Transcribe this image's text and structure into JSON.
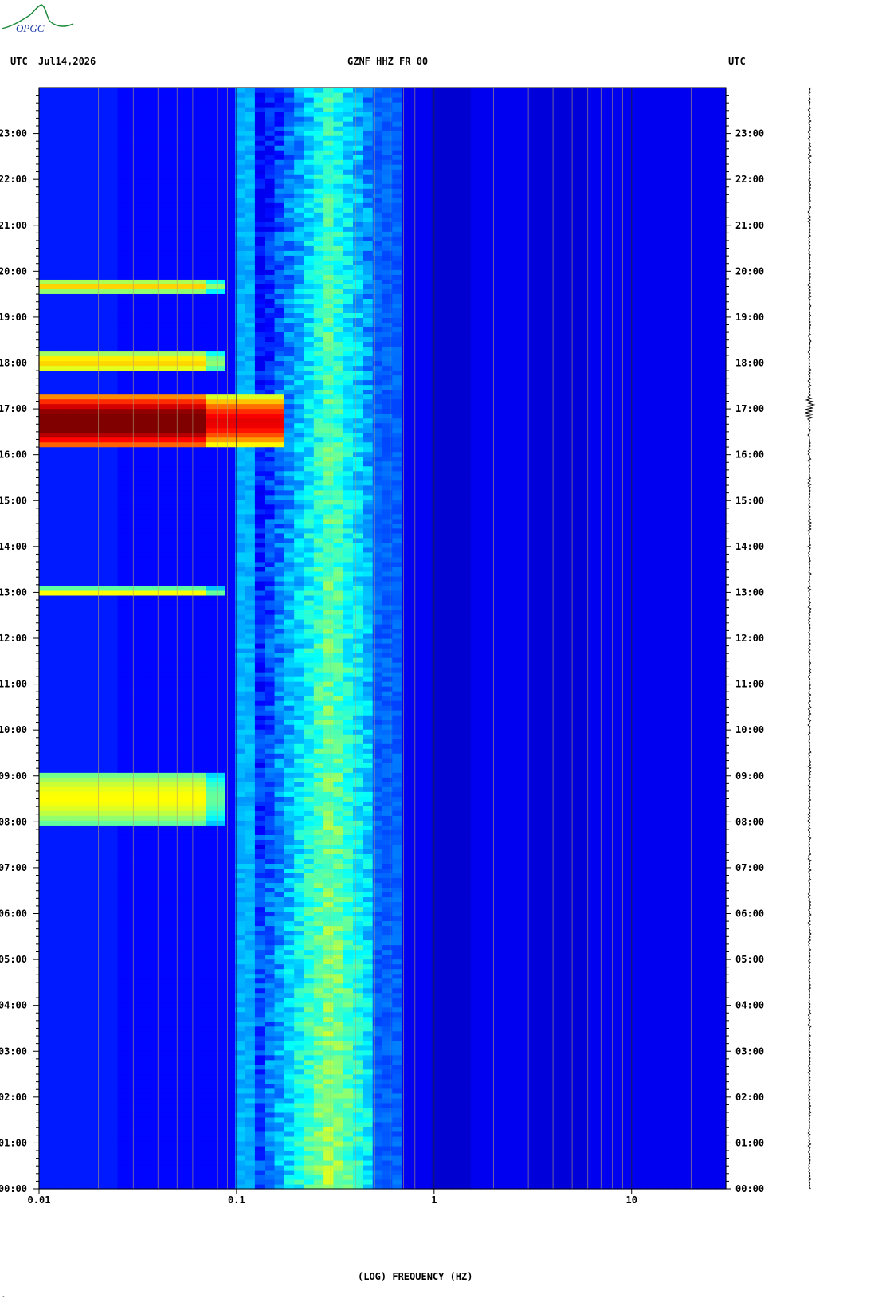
{
  "header": {
    "left_tz": "UTC",
    "date": "Jul14,2026",
    "station": "GZNF HHZ FR 00",
    "right_tz": "UTC"
  },
  "logo": {
    "text": "OPGC"
  },
  "colors": {
    "background_low": "#0a1ca8",
    "grid_line": "#b0a070",
    "low_band": "#0b1fb4"
  },
  "chart_data": {
    "type": "heatmap",
    "title": "GZNF HHZ FR 00",
    "xlabel": "(LOG) FREQUENCY (HZ)",
    "ylabel": "",
    "x_scale": "log",
    "xlim": [
      0.01,
      30
    ],
    "ylim_hours": [
      0,
      24
    ],
    "x_ticks": [
      {
        "value": 0.01,
        "label": "0.01"
      },
      {
        "value": 0.1,
        "label": "0.1"
      },
      {
        "value": 1,
        "label": "1"
      },
      {
        "value": 10,
        "label": "10"
      }
    ],
    "y_ticks": [
      {
        "hour": 0,
        "label": "00:00"
      },
      {
        "hour": 1,
        "label": "01:00"
      },
      {
        "hour": 2,
        "label": "02:00"
      },
      {
        "hour": 3,
        "label": "03:00"
      },
      {
        "hour": 4,
        "label": "04:00"
      },
      {
        "hour": 5,
        "label": "05:00"
      },
      {
        "hour": 6,
        "label": "06:00"
      },
      {
        "hour": 7,
        "label": "07:00"
      },
      {
        "hour": 8,
        "label": "08:00"
      },
      {
        "hour": 9,
        "label": "09:00"
      },
      {
        "hour": 10,
        "label": "10:00"
      },
      {
        "hour": 11,
        "label": "11:00"
      },
      {
        "hour": 12,
        "label": "12:00"
      },
      {
        "hour": 13,
        "label": "13:00"
      },
      {
        "hour": 14,
        "label": "14:00"
      },
      {
        "hour": 15,
        "label": "15:00"
      },
      {
        "hour": 16,
        "label": "16:00"
      },
      {
        "hour": 17,
        "label": "17:00"
      },
      {
        "hour": 18,
        "label": "18:00"
      },
      {
        "hour": 19,
        "label": "19:00"
      },
      {
        "hour": 20,
        "label": "20:00"
      },
      {
        "hour": 21,
        "label": "21:00"
      },
      {
        "hour": 22,
        "label": "22:00"
      },
      {
        "hour": 23,
        "label": "23:00"
      }
    ],
    "microseism_band": {
      "f_low": 0.12,
      "f_peak": 0.3,
      "f_high": 0.5
    },
    "events": [
      {
        "t_start": 16.15,
        "t_end": 17.3,
        "f_max": 0.18,
        "intensity": 1.0
      },
      {
        "t_start": 17.8,
        "t_end": 18.25,
        "f_max": 0.09,
        "intensity": 0.55
      },
      {
        "t_start": 19.55,
        "t_end": 19.8,
        "f_max": 0.085,
        "intensity": 0.55
      },
      {
        "t_start": 12.9,
        "t_end": 13.1,
        "f_max": 0.085,
        "intensity": 0.5
      },
      {
        "t_start": 7.95,
        "t_end": 9.1,
        "f_max": 0.085,
        "intensity": 0.5
      }
    ],
    "trace_event_hour": 17.0
  },
  "footer": {
    "corner_mark": "^"
  }
}
